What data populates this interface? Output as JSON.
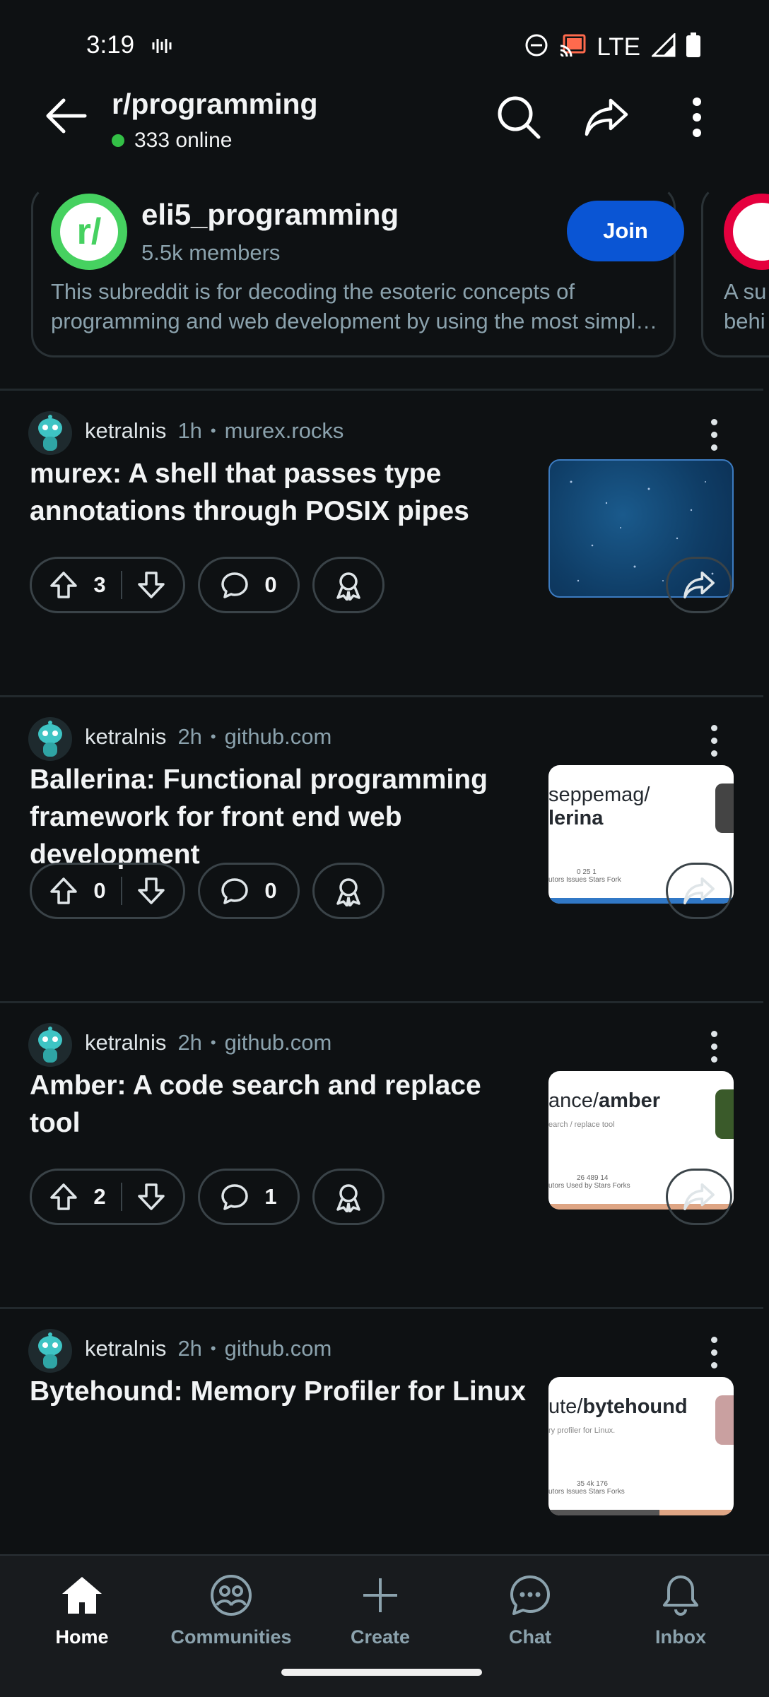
{
  "status_bar": {
    "time": "3:19",
    "network": "LTE"
  },
  "header": {
    "title": "r/programming",
    "online_text": "333 online"
  },
  "recommended": {
    "name": "eli5_programming",
    "members": "5.5k members",
    "description": "This subreddit is for decoding the esoteric concepts of programming and web development by using the most simpl…",
    "join_label": "Join",
    "next_card_desc_partial": "A su behi",
    "next_card_desc_line1": "A su",
    "next_card_desc_line2": "behi"
  },
  "posts": [
    {
      "author": "ketralnis",
      "age": "1h",
      "domain": "murex.rocks",
      "title": "murex: A shell that passes type annotations through POSIX pipes",
      "votes": "3",
      "comments": "0",
      "thumb": {
        "kind": "image"
      }
    },
    {
      "author": "ketralnis",
      "age": "2h",
      "domain": "github.com",
      "title": "Ballerina: Functional programming framework for front end web development",
      "votes": "0",
      "comments": "0",
      "thumb": {
        "kind": "github",
        "text_a": "seppemag/",
        "text_b": "lerina",
        "sub": "",
        "stats": "0     25     1",
        "stats_labels": "utors   Issues   Stars   Fork",
        "bar_color": "#3178c6"
      }
    },
    {
      "author": "ketralnis",
      "age": "2h",
      "domain": "github.com",
      "title": "Amber: A code search and replace tool",
      "votes": "2",
      "comments": "1",
      "thumb": {
        "kind": "github",
        "text_a": "ance/",
        "text_b": "amber",
        "sub": "earch / replace tool",
        "stats": "26     489     14",
        "stats_labels": "utors   Used by   Stars   Forks",
        "bar_color": "#dea584"
      }
    },
    {
      "author": "ketralnis",
      "age": "2h",
      "domain": "github.com",
      "title": "Bytehound: Memory Profiler for Linux",
      "votes": "",
      "comments": "",
      "thumb": {
        "kind": "github",
        "text_a": "ute/",
        "text_b": "bytehound",
        "sub": "ry profiler for Linux.",
        "stats": "35     4k     176",
        "stats_labels": "utors   Issues   Stars   Forks",
        "bar_color": "#dea584"
      }
    }
  ],
  "nav": {
    "items": [
      {
        "label": "Home",
        "icon": "home-icon",
        "active": true
      },
      {
        "label": "Communities",
        "icon": "communities-icon",
        "active": false
      },
      {
        "label": "Create",
        "icon": "plus-icon",
        "active": false
      },
      {
        "label": "Chat",
        "icon": "chat-icon",
        "active": false
      },
      {
        "label": "Inbox",
        "icon": "bell-icon",
        "active": false
      }
    ]
  },
  "colors": {
    "join": "#0a55d4",
    "online": "#33c046",
    "background": "#0e1113"
  }
}
